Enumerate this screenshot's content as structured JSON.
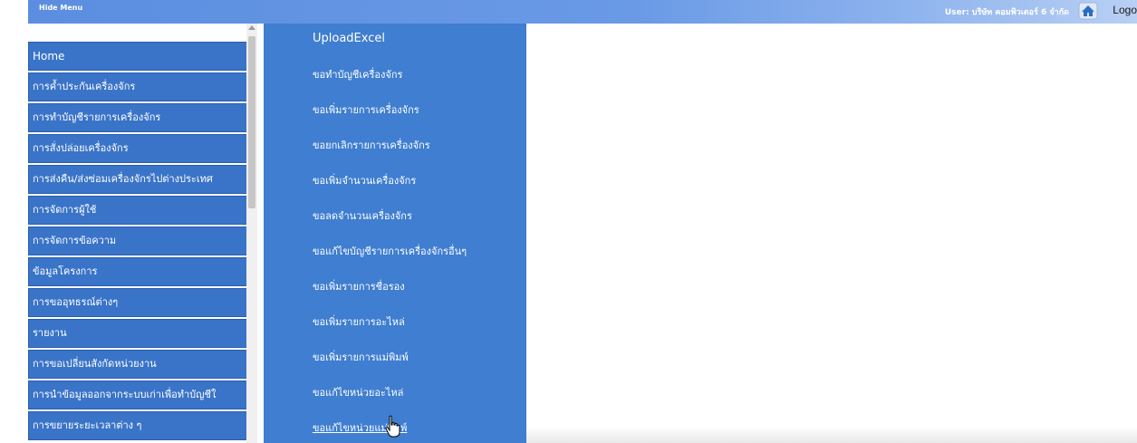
{
  "header": {
    "hide_menu": "Hide Menu",
    "user_label": "User: บริษัท คอมพิวเตอร์ 6 จำกัด",
    "logout": "Logo",
    "home_icon": "home-icon"
  },
  "sidebar": {
    "items": [
      {
        "label": "Home"
      },
      {
        "label": "การค้ำประกันเครื่องจักร"
      },
      {
        "label": "การทำบัญชีรายการเครื่องจักร"
      },
      {
        "label": "การสั่งปล่อยเครื่องจักร"
      },
      {
        "label": "การส่งคืน/ส่งซ่อมเครื่องจักรไปต่างประเทศ"
      },
      {
        "label": "การจัดการผู้ใช้"
      },
      {
        "label": "การจัดการข้อความ"
      },
      {
        "label": "ข้อมูลโครงการ"
      },
      {
        "label": "การขออุทธรณ์ต่างๆ"
      },
      {
        "label": "รายงาน"
      },
      {
        "label": "การขอเปลี่ยนสังกัดหน่วยงาน"
      },
      {
        "label": "การนำข้อมูลออกจากระบบเก่าเพื่อทำบัญชีใ"
      },
      {
        "label": "การขยายระยะเวลาต่าง ๆ"
      }
    ]
  },
  "submenu": {
    "items": [
      {
        "label": "UploadExcel"
      },
      {
        "label": "ขอทำบัญชีเครื่องจักร"
      },
      {
        "label": "ขอเพิ่มรายการเครื่องจักร"
      },
      {
        "label": "ขอยกเลิกรายการเครื่องจักร"
      },
      {
        "label": "ขอเพิ่มจำนวนเครื่องจักร"
      },
      {
        "label": "ขอลดจำนวนเครื่องจักร"
      },
      {
        "label": "ขอแก้ไขบัญชีรายการเครื่องจักรอื่นๆ"
      },
      {
        "label": "ขอเพิ่มรายการชื่อรอง"
      },
      {
        "label": "ขอเพิ่มรายการอะไหล่"
      },
      {
        "label": "ขอเพิ่มรายการแม่พิมพ์"
      },
      {
        "label": "ขอแก้ไขหน่วยอะไหล่"
      },
      {
        "label": "ขอแก้ไขหน่วยแม่พิมพ์"
      }
    ]
  },
  "colors": {
    "menu_blue": "#3a74c8",
    "submenu_blue": "#3f7ed0",
    "header_blue": "#5b8ee0"
  }
}
